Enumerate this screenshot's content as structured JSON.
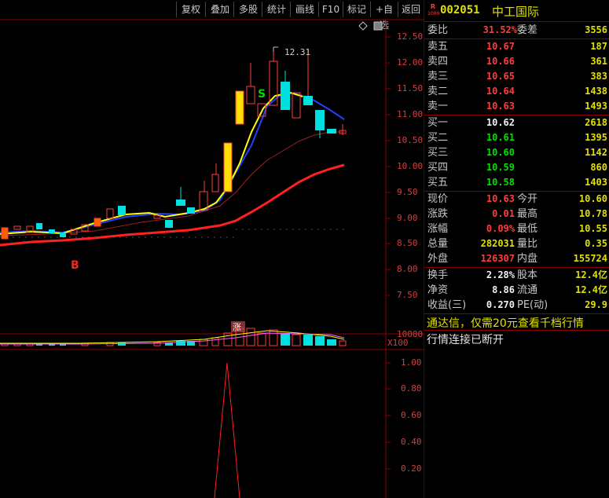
{
  "toolbar": {
    "buttons": [
      "复权",
      "叠加",
      "多股",
      "统计",
      "画线",
      "F10",
      "标记",
      "+自选",
      "返回"
    ]
  },
  "header": {
    "badge_top": "R",
    "badge_bottom": "1000",
    "code": "002051",
    "name": "中工国际"
  },
  "main_chart": {
    "peak_label": "12.31",
    "buy_marker": "B",
    "sell_marker": "S",
    "limit_up_marker": "涨",
    "y_ticks": [
      "12.50",
      "12.00",
      "11.50",
      "11.00",
      "10.50",
      "10.00",
      "9.50",
      "9.00",
      "8.50",
      "8.00",
      "7.50"
    ]
  },
  "volume_chart": {
    "tick": "10000",
    "unit": "X100"
  },
  "indicator_chart": {
    "y_ticks": [
      "1.00",
      "0.80",
      "0.60",
      "0.40",
      "0.20"
    ]
  },
  "quote": {
    "ratio_label": "委比",
    "ratio_value": "31.52%",
    "diff_label": "委差",
    "diff_value": "3556",
    "asks": [
      {
        "label": "卖五",
        "price": "10.67",
        "vol": "187"
      },
      {
        "label": "卖四",
        "price": "10.66",
        "vol": "361"
      },
      {
        "label": "卖三",
        "price": "10.65",
        "vol": "383"
      },
      {
        "label": "卖二",
        "price": "10.64",
        "vol": "1438"
      },
      {
        "label": "卖一",
        "price": "10.63",
        "vol": "1493"
      }
    ],
    "bids": [
      {
        "label": "买一",
        "price": "10.62",
        "vol": "2618"
      },
      {
        "label": "买二",
        "price": "10.61",
        "vol": "1395"
      },
      {
        "label": "买三",
        "price": "10.60",
        "vol": "1142"
      },
      {
        "label": "买四",
        "price": "10.59",
        "vol": "860"
      },
      {
        "label": "买五",
        "price": "10.58",
        "vol": "1403"
      }
    ],
    "stats": [
      {
        "l1": "现价",
        "v1": "10.63",
        "l2": "今开",
        "v2": "10.60"
      },
      {
        "l1": "涨跌",
        "v1": "0.01",
        "l2": "最高",
        "v2": "10.78"
      },
      {
        "l1": "涨幅",
        "v1": "0.09%",
        "l2": "最低",
        "v2": "10.55"
      },
      {
        "l1": "总量",
        "v1": "282031",
        "l2": "量比",
        "v2": "0.35"
      },
      {
        "l1": "外盘",
        "v1": "126307",
        "l2": "内盘",
        "v2": "155724"
      }
    ],
    "fin": [
      {
        "l1": "换手",
        "v1": "2.28%",
        "l2": "股本",
        "v2": "12.4亿"
      },
      {
        "l1": "净资",
        "v1": "8.86",
        "l2": "流通",
        "v2": "12.4亿"
      },
      {
        "l1": "收益(三)",
        "v1": "0.270",
        "l2": "PE(动)",
        "v2": "29.9"
      }
    ],
    "notice": "通达信，仅需20元查看千档行情",
    "status": "行情连接已断开"
  },
  "colors": {
    "up": "#ff3c3c",
    "down": "#00e0e0",
    "ma5": "#ffff00",
    "ma10": "#2040ff",
    "ma20": "#ff2020",
    "grid": "#8a0000"
  }
}
